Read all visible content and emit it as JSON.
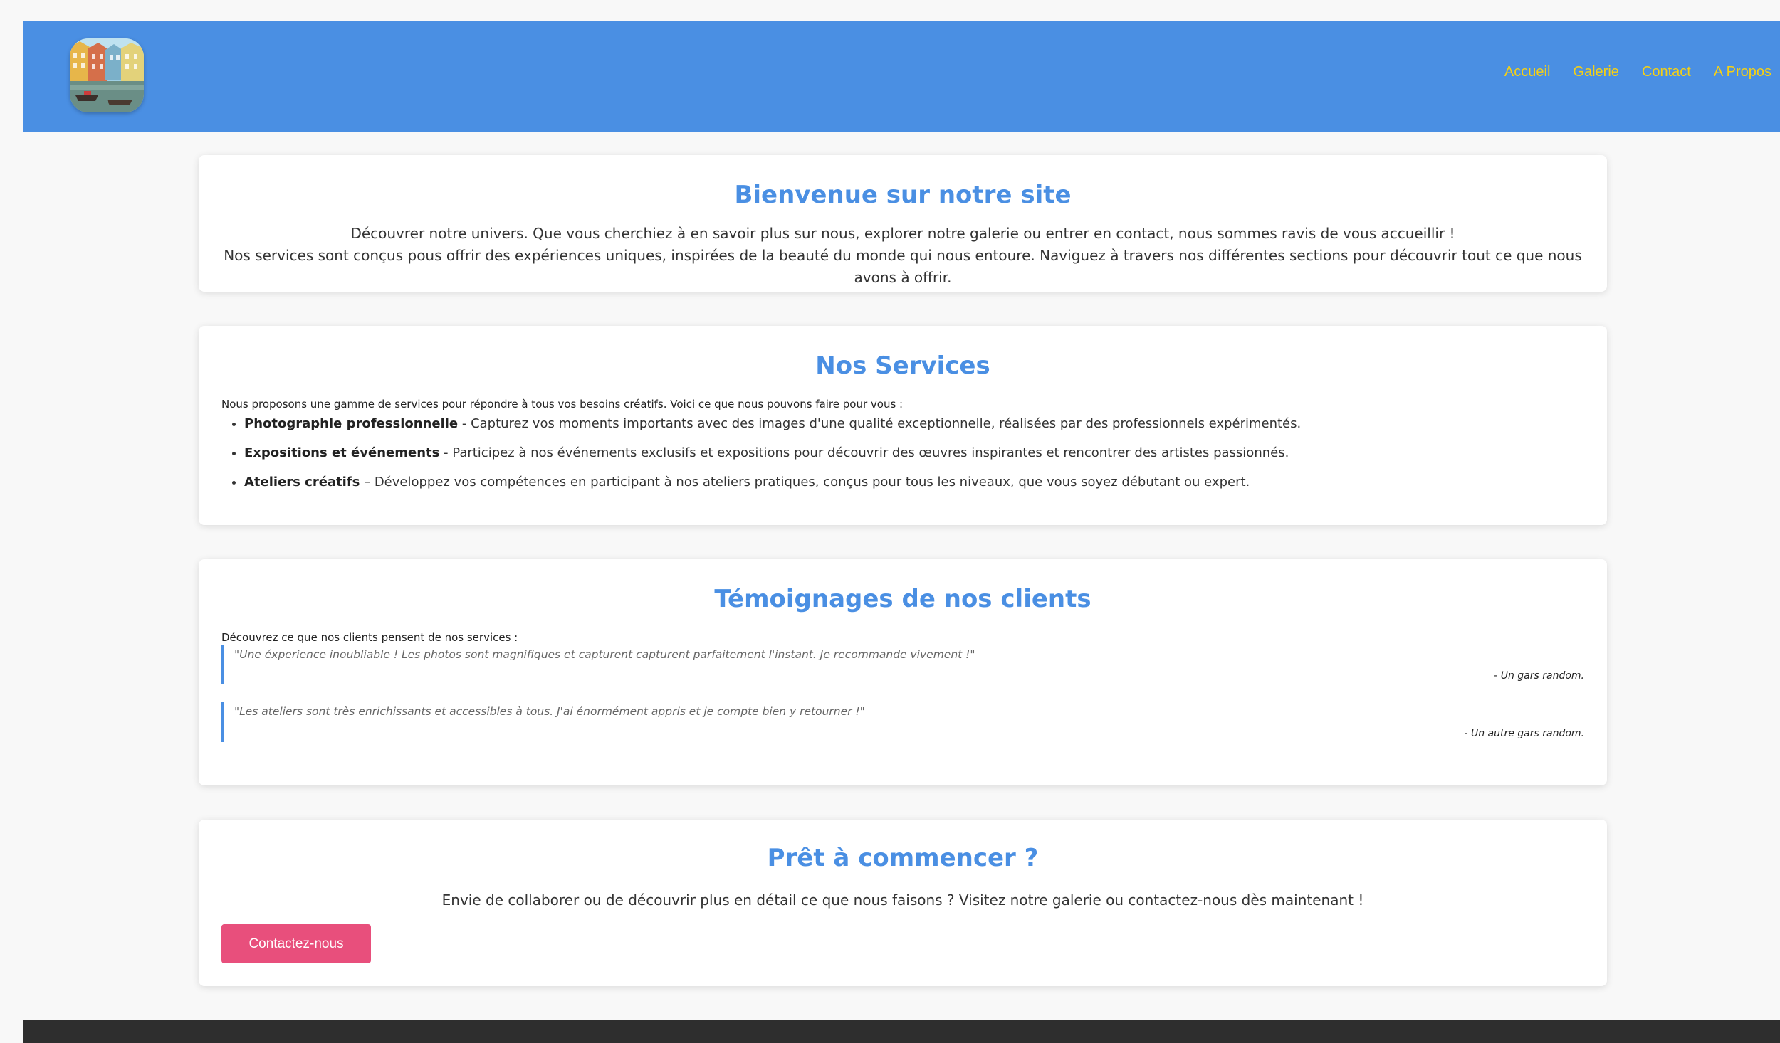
{
  "header": {
    "logo_alt": "logo",
    "nav": [
      "Accueil",
      "Galerie",
      "Contact",
      "A Propos"
    ]
  },
  "welcome": {
    "title": "Bienvenue sur notre site",
    "line1": "Découvrer notre univers. Que vous cherchiez à en savoir plus sur nous, explorer notre galerie ou entrer en contact, nous sommes ravis de vous accueillir !",
    "line2": "Nos services sont conçus pous offrir des expériences uniques, inspirées de la beauté du monde qui nous entoure. Naviguez à travers nos différentes sections pour découvrir tout ce que nous avons à offrir."
  },
  "services": {
    "title": "Nos Services",
    "intro": "Nous proposons une gamme de services pour répondre à tous vos besoins créatifs. Voici ce que nous pouvons faire pour vous :",
    "items": [
      {
        "name": "Photographie professionnelle",
        "desc": " - Capturez vos moments importants avec des images d'une qualité exceptionnelle, réalisées par des professionnels expérimentés."
      },
      {
        "name": "Expositions et événements",
        "desc": " - Participez à nos événements exclusifs et expositions pour découvrir des œuvres inspirantes et rencontrer des artistes passionnés."
      },
      {
        "name": "Ateliers créatifs",
        "desc": " – Développez vos compétences en participant à nos ateliers pratiques, conçus pour tous les niveaux, que vous soyez débutant ou expert."
      }
    ]
  },
  "testimonials": {
    "title": "Témoignages de nos clients",
    "intro": "Découvrez ce que nos clients pensent de nos services :",
    "items": [
      {
        "quote": "\"Une éxperience inoubliable ! Les photos sont magnifiques et capturent capturent parfaitement l'instant. Je recommande vivement !\"",
        "author": "- Un gars random."
      },
      {
        "quote": "\"Les ateliers sont très enrichissants et accessibles à tous. J'ai énormément appris et je compte bien y retourner !\"",
        "author": "- Un autre gars random."
      }
    ]
  },
  "cta": {
    "title": "Prêt à commencer ?",
    "text": "Envie de collaborer ou de découvrir plus en détail ce que nous faisons ? Visitez notre galerie ou contactez-nous dès maintenant !",
    "button": "Contactez-nous",
    "button_color": "#e84f7c"
  },
  "colors": {
    "header": "#4a8fe3",
    "nav_link": "#f5d015",
    "heading": "#4a8fe3",
    "footer": "#2e2e2e"
  }
}
